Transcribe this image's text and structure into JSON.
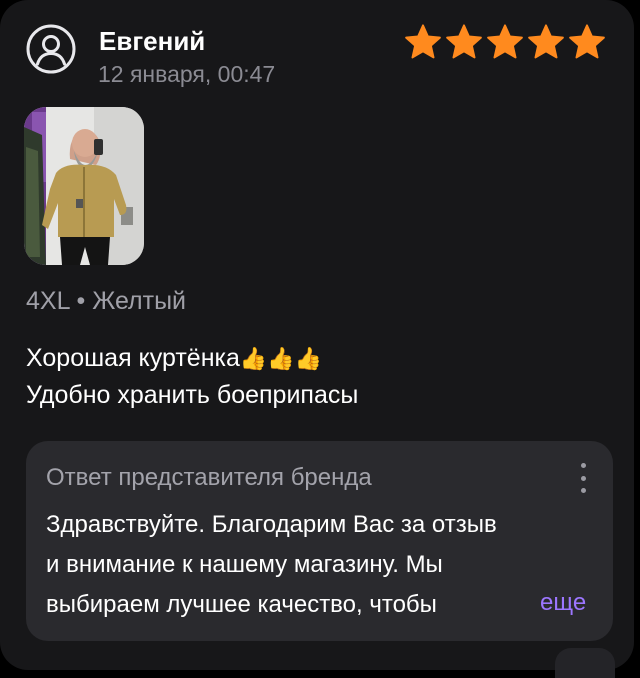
{
  "review": {
    "author": "Евгений",
    "date": "12 января, 00:47",
    "rating": 5,
    "rating_max": 5,
    "star_color": "#ff8a1e",
    "photo_icon": "review-photo",
    "variant": "4XL • Желтый",
    "text_lines": [
      "Хорошая куртёнка",
      "Удобно хранить боеприпасы"
    ],
    "emoji": "👍👍👍"
  },
  "brand_reply": {
    "title": "Ответ представителя бренда",
    "lines": [
      "Здравствуйте. Благодарим Вас за отзыв",
      "и внимание к нашему магазину. Мы",
      "выбираем лучшее качество, чтобы"
    ],
    "more_label": "еще",
    "more_color": "#9c76ff"
  }
}
